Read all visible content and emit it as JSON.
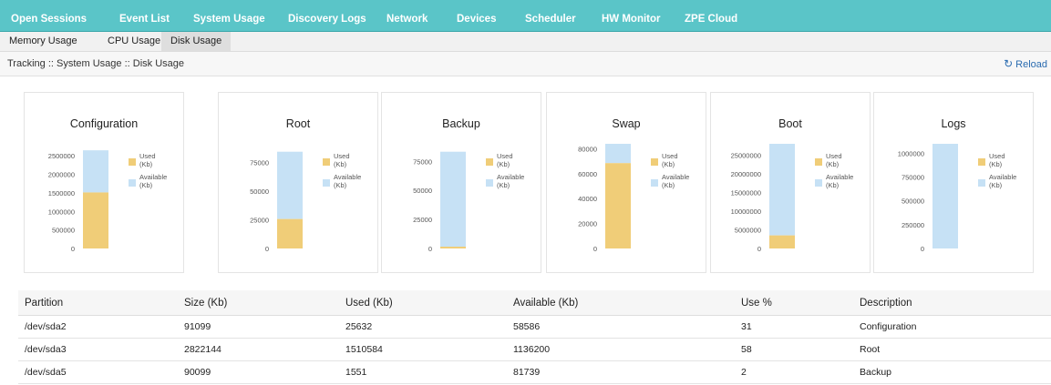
{
  "top_nav": [
    {
      "label": "Open Sessions"
    },
    {
      "label": "Event List"
    },
    {
      "label": "System Usage"
    },
    {
      "label": "Discovery Logs"
    },
    {
      "label": "Network"
    },
    {
      "label": "Devices"
    },
    {
      "label": "Scheduler"
    },
    {
      "label": "HW Monitor"
    },
    {
      "label": "ZPE Cloud"
    }
  ],
  "sub_tabs": [
    {
      "label": "Memory Usage"
    },
    {
      "label": "CPU Usage"
    },
    {
      "label": "Disk Usage",
      "active": true
    }
  ],
  "breadcrumb": "Tracking :: System Usage :: Disk Usage",
  "reload": {
    "label": "Reload",
    "icon": "refresh-icon"
  },
  "colors": {
    "used": "#f0cd78",
    "available": "#c6e1f5",
    "nav": "#5ac5c8"
  },
  "chart_data": [
    {
      "type": "bar",
      "title": "Configuration",
      "ylim": [
        0,
        2822144
      ],
      "y_ticks": [
        "2500000",
        "2000000",
        "1500000",
        "1000000",
        "500000",
        "0"
      ],
      "series": [
        {
          "name": "Used (Kb)",
          "values": [
            1510584
          ]
        },
        {
          "name": "Available (Kb)",
          "values": [
            1136200
          ]
        }
      ]
    },
    {
      "type": "bar",
      "title": "Root",
      "ylim": [
        0,
        91099
      ],
      "y_ticks": [
        "75000",
        "50000",
        "25000",
        "0"
      ],
      "series": [
        {
          "name": "Used (Kb)",
          "values": [
            25632
          ]
        },
        {
          "name": "Available (Kb)",
          "values": [
            58586
          ]
        }
      ]
    },
    {
      "type": "bar",
      "title": "Backup",
      "ylim": [
        0,
        90099
      ],
      "y_ticks": [
        "75000",
        "50000",
        "25000",
        "0"
      ],
      "series": [
        {
          "name": "Used (Kb)",
          "values": [
            1551
          ]
        },
        {
          "name": "Available (Kb)",
          "values": [
            81739
          ]
        }
      ]
    },
    {
      "type": "bar",
      "title": "Swap",
      "ylim": [
        0,
        84000
      ],
      "y_ticks": [
        "80000",
        "60000",
        "40000",
        "20000",
        "0"
      ],
      "series": [
        {
          "name": "Used (Kb)",
          "values": [
            68500
          ]
        },
        {
          "name": "Available (Kb)",
          "values": [
            15500
          ]
        }
      ]
    },
    {
      "type": "bar",
      "title": "Boot",
      "ylim": [
        0,
        28000000
      ],
      "y_ticks": [
        "25000000",
        "20000000",
        "15000000",
        "10000000",
        "5000000",
        "0"
      ],
      "series": [
        {
          "name": "Used (Kb)",
          "values": [
            3500000
          ]
        },
        {
          "name": "Available (Kb)",
          "values": [
            24500000
          ]
        }
      ]
    },
    {
      "type": "bar",
      "title": "Logs",
      "ylim": [
        0,
        1100000
      ],
      "y_ticks": [
        "1000000",
        "750000",
        "500000",
        "250000",
        "0"
      ],
      "series": [
        {
          "name": "Used (Kb)",
          "values": [
            0
          ]
        },
        {
          "name": "Available (Kb)",
          "values": [
            1100000
          ]
        }
      ]
    }
  ],
  "table": {
    "headers": [
      "Partition",
      "Size (Kb)",
      "Used (Kb)",
      "Available (Kb)",
      "Use %",
      "Description"
    ],
    "rows": [
      [
        "/dev/sda2",
        "91099",
        "25632",
        "58586",
        "31",
        "Configuration"
      ],
      [
        "/dev/sda3",
        "2822144",
        "1510584",
        "1136200",
        "58",
        "Root"
      ],
      [
        "/dev/sda5",
        "90099",
        "1551",
        "81739",
        "2",
        "Backup"
      ]
    ]
  }
}
